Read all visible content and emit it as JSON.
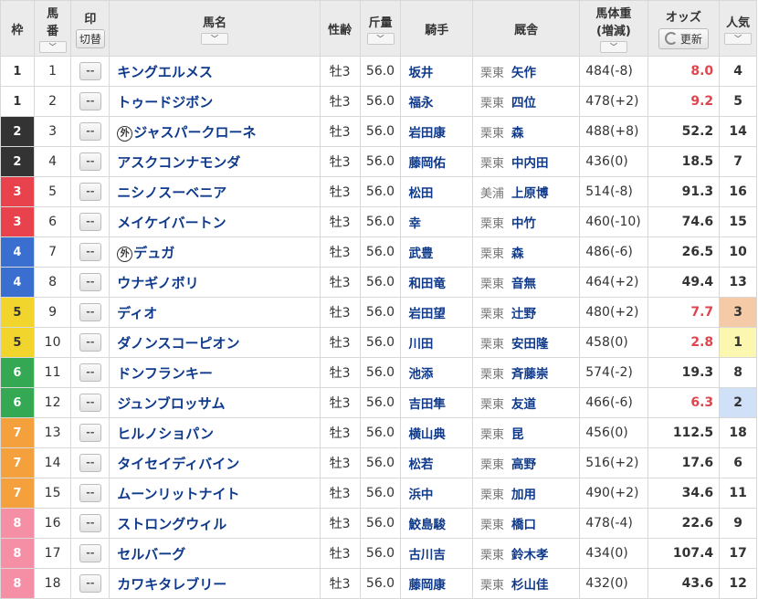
{
  "headers": {
    "waku": "枠",
    "umaban_1": "馬",
    "umaban_2": "番",
    "mark": "印",
    "mark_toggle": "切替",
    "horse_name": "馬名",
    "sex_age": "性齢",
    "weight": "斤量",
    "jockey": "騎手",
    "trainer": "厩舎",
    "body_weight_1": "馬体重",
    "body_weight_2": "(増減)",
    "odds": "オッズ",
    "refresh": "更新",
    "popularity_1": "人気",
    "chevron": "﹀"
  },
  "colors": {
    "waku_1": "#ffffff",
    "waku_2": "#333333",
    "waku_3": "#e8434c",
    "waku_4": "#3a6fd0",
    "waku_5": "#f2d52c",
    "waku_6": "#34a853",
    "waku_7": "#f4a13d",
    "waku_8": "#f48fa6",
    "odds_hot": "#e0444d",
    "link": "#0f3a8c"
  },
  "gai_label": "外",
  "mark_placeholder": "--",
  "rows": [
    {
      "waku": "1",
      "num": "1",
      "foreign": false,
      "name": "キングエルメス",
      "sex": "牡3",
      "wt": "56.0",
      "jockey": "坂井",
      "region": "栗東",
      "trainer": "矢作",
      "body": "484(-8)",
      "odds": "8.0",
      "hot": true,
      "pop": "4",
      "popclass": ""
    },
    {
      "waku": "1",
      "num": "2",
      "foreign": false,
      "name": "トゥードジボン",
      "sex": "牡3",
      "wt": "56.0",
      "jockey": "福永",
      "region": "栗東",
      "trainer": "四位",
      "body": "478(+2)",
      "odds": "9.2",
      "hot": true,
      "pop": "5",
      "popclass": ""
    },
    {
      "waku": "2",
      "num": "3",
      "foreign": true,
      "name": "ジャスパークローネ",
      "sex": "牡3",
      "wt": "56.0",
      "jockey": "岩田康",
      "region": "栗東",
      "trainer": "森",
      "body": "488(+8)",
      "odds": "52.2",
      "hot": false,
      "pop": "14",
      "popclass": ""
    },
    {
      "waku": "2",
      "num": "4",
      "foreign": false,
      "name": "アスクコンナモンダ",
      "sex": "牡3",
      "wt": "56.0",
      "jockey": "藤岡佑",
      "region": "栗東",
      "trainer": "中内田",
      "body": "436(0)",
      "odds": "18.5",
      "hot": false,
      "pop": "7",
      "popclass": ""
    },
    {
      "waku": "3",
      "num": "5",
      "foreign": false,
      "name": "ニシノスーベニア",
      "sex": "牡3",
      "wt": "56.0",
      "jockey": "松田",
      "region": "美浦",
      "trainer": "上原博",
      "body": "514(-8)",
      "odds": "91.3",
      "hot": false,
      "pop": "16",
      "popclass": ""
    },
    {
      "waku": "3",
      "num": "6",
      "foreign": false,
      "name": "メイケイバートン",
      "sex": "牡3",
      "wt": "56.0",
      "jockey": "幸",
      "region": "栗東",
      "trainer": "中竹",
      "body": "460(-10)",
      "odds": "74.6",
      "hot": false,
      "pop": "15",
      "popclass": ""
    },
    {
      "waku": "4",
      "num": "7",
      "foreign": true,
      "name": "デュガ",
      "sex": "牡3",
      "wt": "56.0",
      "jockey": "武豊",
      "region": "栗東",
      "trainer": "森",
      "body": "486(-6)",
      "odds": "26.5",
      "hot": false,
      "pop": "10",
      "popclass": ""
    },
    {
      "waku": "4",
      "num": "8",
      "foreign": false,
      "name": "ウナギノボリ",
      "sex": "牡3",
      "wt": "56.0",
      "jockey": "和田竜",
      "region": "栗東",
      "trainer": "音無",
      "body": "464(+2)",
      "odds": "49.4",
      "hot": false,
      "pop": "13",
      "popclass": ""
    },
    {
      "waku": "5",
      "num": "9",
      "foreign": false,
      "name": "ディオ",
      "sex": "牡3",
      "wt": "56.0",
      "jockey": "岩田望",
      "region": "栗東",
      "trainer": "辻野",
      "body": "480(+2)",
      "odds": "7.7",
      "hot": true,
      "pop": "3",
      "popclass": "pop-3"
    },
    {
      "waku": "5",
      "num": "10",
      "foreign": false,
      "name": "ダノンスコーピオン",
      "sex": "牡3",
      "wt": "56.0",
      "jockey": "川田",
      "region": "栗東",
      "trainer": "安田隆",
      "body": "458(0)",
      "odds": "2.8",
      "hot": true,
      "pop": "1",
      "popclass": "pop-1"
    },
    {
      "waku": "6",
      "num": "11",
      "foreign": false,
      "name": "ドンフランキー",
      "sex": "牡3",
      "wt": "56.0",
      "jockey": "池添",
      "region": "栗東",
      "trainer": "斉藤崇",
      "body": "574(-2)",
      "odds": "19.3",
      "hot": false,
      "pop": "8",
      "popclass": ""
    },
    {
      "waku": "6",
      "num": "12",
      "foreign": false,
      "name": "ジュンブロッサム",
      "sex": "牡3",
      "wt": "56.0",
      "jockey": "吉田隼",
      "region": "栗東",
      "trainer": "友道",
      "body": "466(-6)",
      "odds": "6.3",
      "hot": true,
      "pop": "2",
      "popclass": "pop-2"
    },
    {
      "waku": "7",
      "num": "13",
      "foreign": false,
      "name": "ヒルノショパン",
      "sex": "牡3",
      "wt": "56.0",
      "jockey": "横山典",
      "region": "栗東",
      "trainer": "昆",
      "body": "456(0)",
      "odds": "112.5",
      "hot": false,
      "pop": "18",
      "popclass": ""
    },
    {
      "waku": "7",
      "num": "14",
      "foreign": false,
      "name": "タイセイディバイン",
      "sex": "牡3",
      "wt": "56.0",
      "jockey": "松若",
      "region": "栗東",
      "trainer": "高野",
      "body": "516(+2)",
      "odds": "17.6",
      "hot": false,
      "pop": "6",
      "popclass": ""
    },
    {
      "waku": "7",
      "num": "15",
      "foreign": false,
      "name": "ムーンリットナイト",
      "sex": "牡3",
      "wt": "56.0",
      "jockey": "浜中",
      "region": "栗東",
      "trainer": "加用",
      "body": "490(+2)",
      "odds": "34.6",
      "hot": false,
      "pop": "11",
      "popclass": ""
    },
    {
      "waku": "8",
      "num": "16",
      "foreign": false,
      "name": "ストロングウィル",
      "sex": "牡3",
      "wt": "56.0",
      "jockey": "鮫島駿",
      "region": "栗東",
      "trainer": "橋口",
      "body": "478(-4)",
      "odds": "22.6",
      "hot": false,
      "pop": "9",
      "popclass": ""
    },
    {
      "waku": "8",
      "num": "17",
      "foreign": false,
      "name": "セルバーグ",
      "sex": "牡3",
      "wt": "56.0",
      "jockey": "古川吉",
      "region": "栗東",
      "trainer": "鈴木孝",
      "body": "434(0)",
      "odds": "107.4",
      "hot": false,
      "pop": "17",
      "popclass": ""
    },
    {
      "waku": "8",
      "num": "18",
      "foreign": false,
      "name": "カワキタレブリー",
      "sex": "牡3",
      "wt": "56.0",
      "jockey": "藤岡康",
      "region": "栗東",
      "trainer": "杉山佳",
      "body": "432(0)",
      "odds": "43.6",
      "hot": false,
      "pop": "12",
      "popclass": ""
    }
  ]
}
